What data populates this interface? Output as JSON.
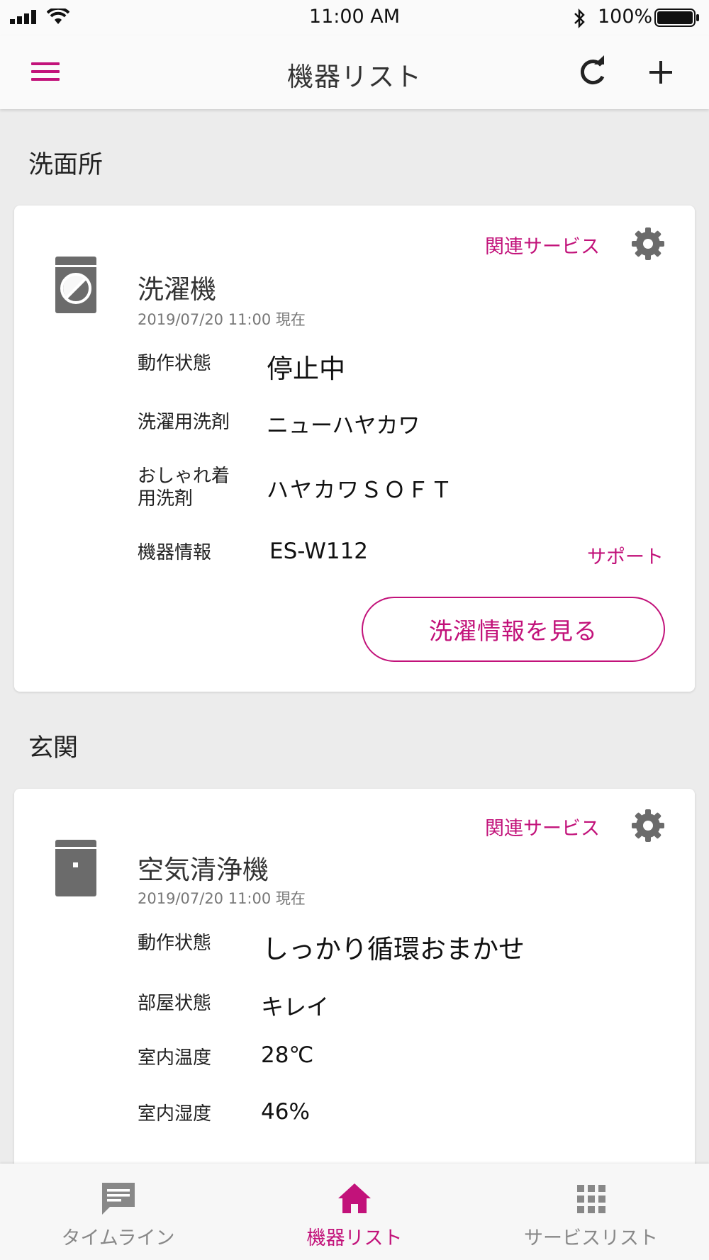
{
  "status_bar": {
    "time": "11:00 AM",
    "battery": "100%"
  },
  "app_bar": {
    "title": "機器リスト",
    "icons": [
      "menu-icon",
      "refresh-icon",
      "add-icon"
    ]
  },
  "colors": {
    "accent": "#c2127a",
    "icon_gray": "#6b6b6b",
    "background": "#ececec"
  },
  "sections": [
    {
      "title": "洗面所",
      "device": {
        "icon": "washing-machine-icon",
        "related_services": "関連サービス",
        "name": "洗濯機",
        "timestamp": "2019/07/20 11:00 現在",
        "rows": [
          {
            "label": "動作状態",
            "value": "停止中"
          },
          {
            "label": "洗濯用洗剤",
            "value": "ニューハヤカワ"
          },
          {
            "label_line1": "おしゃれ着",
            "label_line2": "用洗剤",
            "value": "ハヤカワＳＯＦＴ"
          },
          {
            "label": "機器情報",
            "value": "ES-W112",
            "link": "サポート"
          }
        ],
        "action_button": "洗濯情報を見る"
      }
    },
    {
      "title": "玄関",
      "device": {
        "icon": "air-purifier-icon",
        "related_services": "関連サービス",
        "name": "空気清浄機",
        "timestamp": "2019/07/20 11:00 現在",
        "rows": [
          {
            "label": "動作状態",
            "value": "しっかり循環おまかせ"
          },
          {
            "label": "部屋状態",
            "value": "キレイ"
          },
          {
            "label": "室内温度",
            "value": "28℃"
          },
          {
            "label": "室内湿度",
            "value": "46%"
          }
        ]
      }
    }
  ],
  "bottom_nav": [
    {
      "label": "タイムライン",
      "icon": "timeline-icon",
      "active": false
    },
    {
      "label": "機器リスト",
      "icon": "home-icon",
      "active": true
    },
    {
      "label": "サービスリスト",
      "icon": "grid-icon",
      "active": false
    }
  ]
}
